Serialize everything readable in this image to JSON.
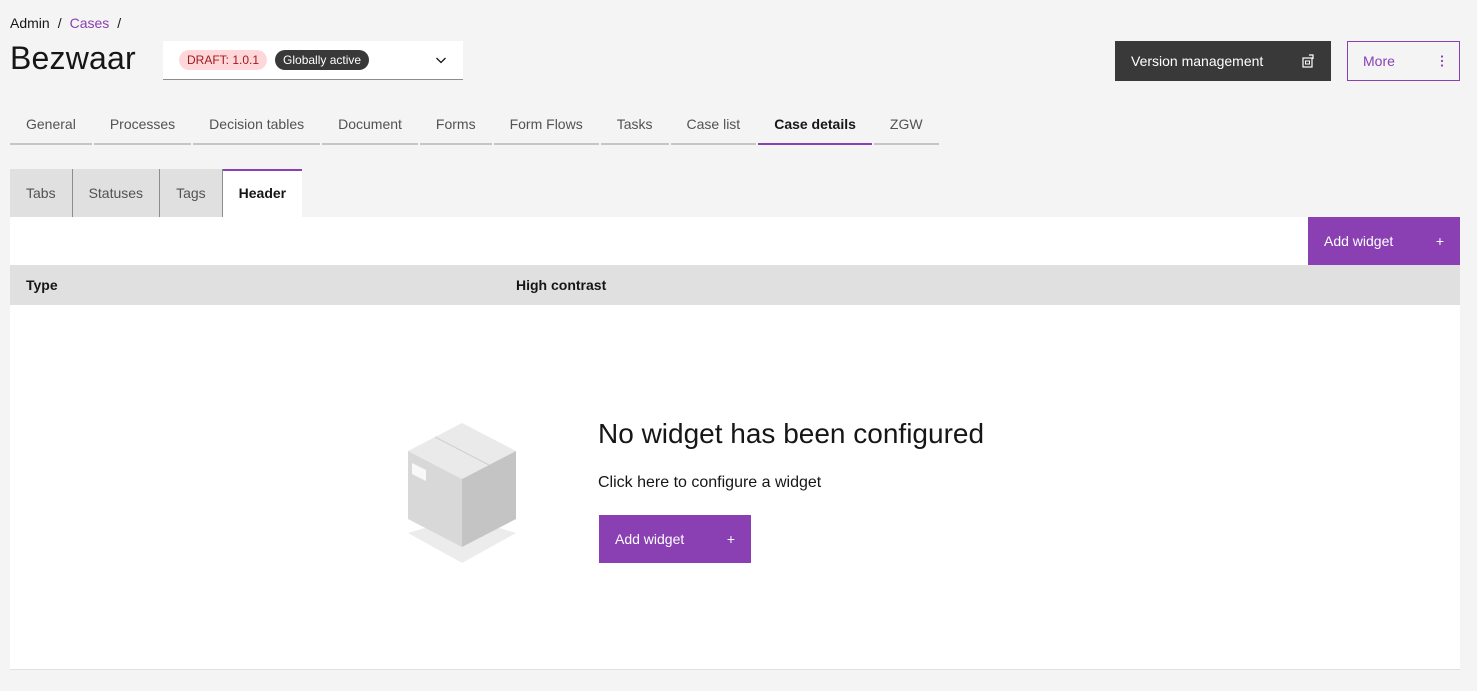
{
  "breadcrumb": {
    "root": "Admin",
    "sep1": "/",
    "cases": "Cases",
    "sep2": "/"
  },
  "page": {
    "title": "Bezwaar"
  },
  "version": {
    "draft_tag": "DRAFT: 1.0.1",
    "active_tag": "Globally active"
  },
  "actions": {
    "version_management": "Version management",
    "more": "More"
  },
  "main_tabs": [
    {
      "label": "General"
    },
    {
      "label": "Processes"
    },
    {
      "label": "Decision tables"
    },
    {
      "label": "Document"
    },
    {
      "label": "Forms"
    },
    {
      "label": "Form Flows"
    },
    {
      "label": "Tasks"
    },
    {
      "label": "Case list"
    },
    {
      "label": "Case details"
    },
    {
      "label": "ZGW"
    }
  ],
  "sub_tabs": [
    {
      "label": "Tabs"
    },
    {
      "label": "Statuses"
    },
    {
      "label": "Tags"
    },
    {
      "label": "Header"
    }
  ],
  "toolbar": {
    "add_widget": "Add widget",
    "add_icon": "+"
  },
  "table": {
    "col_type": "Type",
    "col_high_contrast": "High contrast"
  },
  "empty": {
    "title": "No widget has been configured",
    "subtitle": "Click here to configure a widget",
    "button": "Add widget",
    "button_icon": "+"
  },
  "colors": {
    "accent": "#8a3fb3",
    "dark": "#393939",
    "draft_bg": "#ffd7d9",
    "draft_fg": "#a2191f"
  }
}
